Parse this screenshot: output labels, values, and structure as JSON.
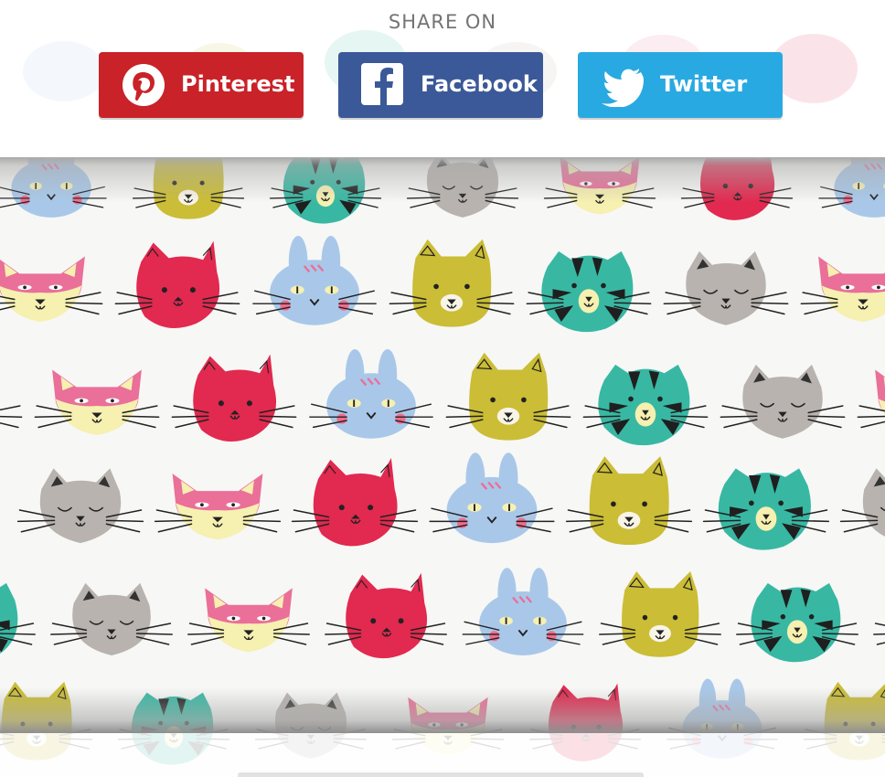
{
  "share": {
    "title": "SHARE ON",
    "buttons": [
      {
        "label": "Pinterest",
        "icon": "pinterest-logo-icon",
        "color": "#c92228"
      },
      {
        "label": "Facebook",
        "icon": "facebook-logo-icon",
        "color": "#3b5998"
      },
      {
        "label": "Twitter",
        "icon": "twitter-bird-icon",
        "color": "#29a9e1"
      }
    ]
  },
  "artwork": {
    "motif": "cat-faces-pattern",
    "colors": {
      "red": "#e2294f",
      "pink": "#ea6f99",
      "cream": "#f6f0b1",
      "blue": "#a9c8e9",
      "yellow": "#cbbd35",
      "teal": "#38b8a3",
      "gray": "#b8b3ae"
    }
  }
}
